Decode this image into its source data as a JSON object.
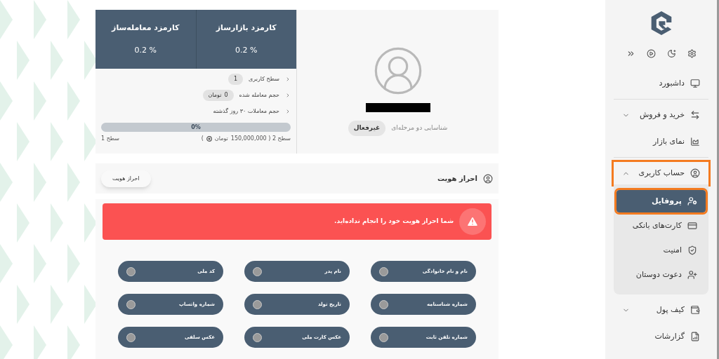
{
  "profile": {
    "two_factor_label": "شناسایی دو مرحله‌ای",
    "two_factor_status": "غیرفعال"
  },
  "fees": [
    {
      "title": "کارمزد بازارساز",
      "value": "0.2 %"
    },
    {
      "title": "کارمزد معامله‌ساز",
      "value": "0.2 %"
    }
  ],
  "stats": [
    {
      "label": "سطح کاربری",
      "value": "1"
    },
    {
      "label": "حجم معامله شده",
      "value": "0",
      "unit": "تومان"
    },
    {
      "label": "حجم معاملات ۳۰ روز گذشته"
    }
  ],
  "progress": {
    "level": 0,
    "reading": "0%",
    "next_level": "سطح 2 ( 150,000,000",
    "next_unit": "تومان",
    "close": ")",
    "current_level": "سطح 1"
  },
  "identity": {
    "title": "احراز هویت",
    "button": "احراز هویت",
    "alert": "شما احراز هویت خود را انجام نداده‌اید.",
    "fields": [
      {
        "label": "نام و نام خانوادگی",
        "done": false
      },
      {
        "label": "نام پدر",
        "done": false
      },
      {
        "label": "کد ملی",
        "done": false
      },
      {
        "label": "شماره شناسنامه",
        "done": false
      },
      {
        "label": "تاریخ تولد",
        "done": false
      },
      {
        "label": "شماره واتساپ",
        "done": false
      },
      {
        "label": "شماره تلفن ثابت",
        "done": false
      },
      {
        "label": "عکس کارت ملی",
        "done": false
      },
      {
        "label": "عکس سلفی",
        "done": false
      }
    ]
  },
  "sidebar": {
    "items": [
      {
        "label": "داشبورد",
        "selected": false,
        "highlighted": false
      },
      {
        "kind": "divider"
      },
      {
        "label": "خرید و فروش",
        "selected": false,
        "highlighted": false,
        "expanded": false
      },
      {
        "label": "نمای بازار",
        "selected": false,
        "highlighted": false
      },
      {
        "kind": "divider"
      },
      {
        "label": "حساب کاربری",
        "selected": false,
        "highlighted": true,
        "expanded": true,
        "children": [
          {
            "label": "پروفایل",
            "selected": true,
            "highlighted": true
          },
          {
            "label": "کارت‌های بانکی",
            "selected": false,
            "highlighted": false
          },
          {
            "label": "امنیت",
            "selected": false,
            "highlighted": false
          },
          {
            "label": "دعوت دوستان",
            "selected": false,
            "highlighted": false
          }
        ]
      },
      {
        "label": "کیف پول",
        "selected": false,
        "highlighted": false,
        "expanded": false
      },
      {
        "label": "گزارشات",
        "selected": false,
        "highlighted": false
      }
    ]
  }
}
